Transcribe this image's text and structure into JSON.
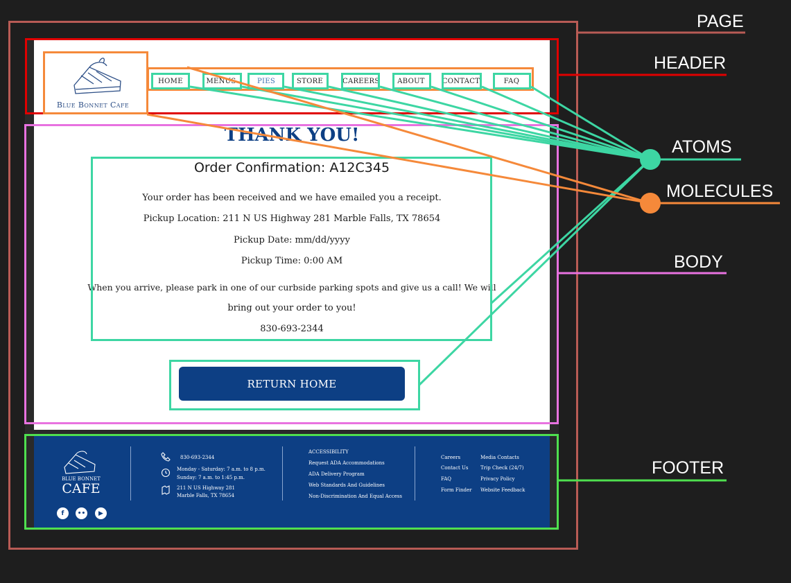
{
  "labels": {
    "page": "PAGE",
    "header": "HEADER",
    "atoms": "ATOMS",
    "molecules": "MOLECULES",
    "body": "BODY",
    "footer": "FOOTER"
  },
  "brand": {
    "name": "Blue Bonnet Cafe"
  },
  "nav": [
    {
      "label": "HOME"
    },
    {
      "label": "MENUS"
    },
    {
      "label": "PIES",
      "active": true
    },
    {
      "label": "STORE"
    },
    {
      "label": "CAREERS"
    },
    {
      "label": "ABOUT"
    },
    {
      "label": "CONTACT"
    },
    {
      "label": "FAQ"
    }
  ],
  "main": {
    "heading": "THANK YOU!",
    "confirmation_title": "Order Confirmation: A12C345",
    "received": "Your order has been received and we have emailed you a receipt.",
    "location": "Pickup Location: 211 N US Highway 281 Marble Falls, TX 78654",
    "date": "Pickup Date: mm/dd/yyyy",
    "time": "Pickup Time: 0:00 AM",
    "arrive_line1": "When you arrive, please park in one of our curbside parking spots and give us a call! We will",
    "arrive_line2": "bring out your order to you!",
    "phone": "830-693-2344",
    "return_button": "RETURN HOME"
  },
  "footer": {
    "logo_line1": "BLUE BONNET",
    "logo_line2": "CAFE",
    "phone": "830-693-2344",
    "hours1": "Monday - Saturday: 7 a.m. to 8 p.m.",
    "hours2": "Sunday: 7 a.m. to 1:45 p.m.",
    "address1": "211 N US Highway 281",
    "address2": "Marble Falls, TX 78654",
    "accessibility": [
      "ACCESSIBILITY",
      "Request ADA Accommodations",
      "ADA Delivery Program",
      "Web Standards And Guidelines",
      "Non-Discrimination And Equal Access"
    ],
    "links_col1": [
      "Careers",
      "Contact Us",
      "FAQ",
      "Form Finder"
    ],
    "links_col2": [
      "Media Contacts",
      "Trip Check (24/7)",
      "Privacy Policy",
      "Website Feedback"
    ],
    "social": [
      "facebook-icon",
      "flickr-icon",
      "youtube-icon"
    ]
  },
  "colors": {
    "page": "#b85b55",
    "header": "#e00000",
    "atoms": "#3dd6a3",
    "molecules": "#f5893a",
    "body": "#e872e0",
    "footer": "#4fe04f",
    "brand_blue": "#0d3f84"
  }
}
